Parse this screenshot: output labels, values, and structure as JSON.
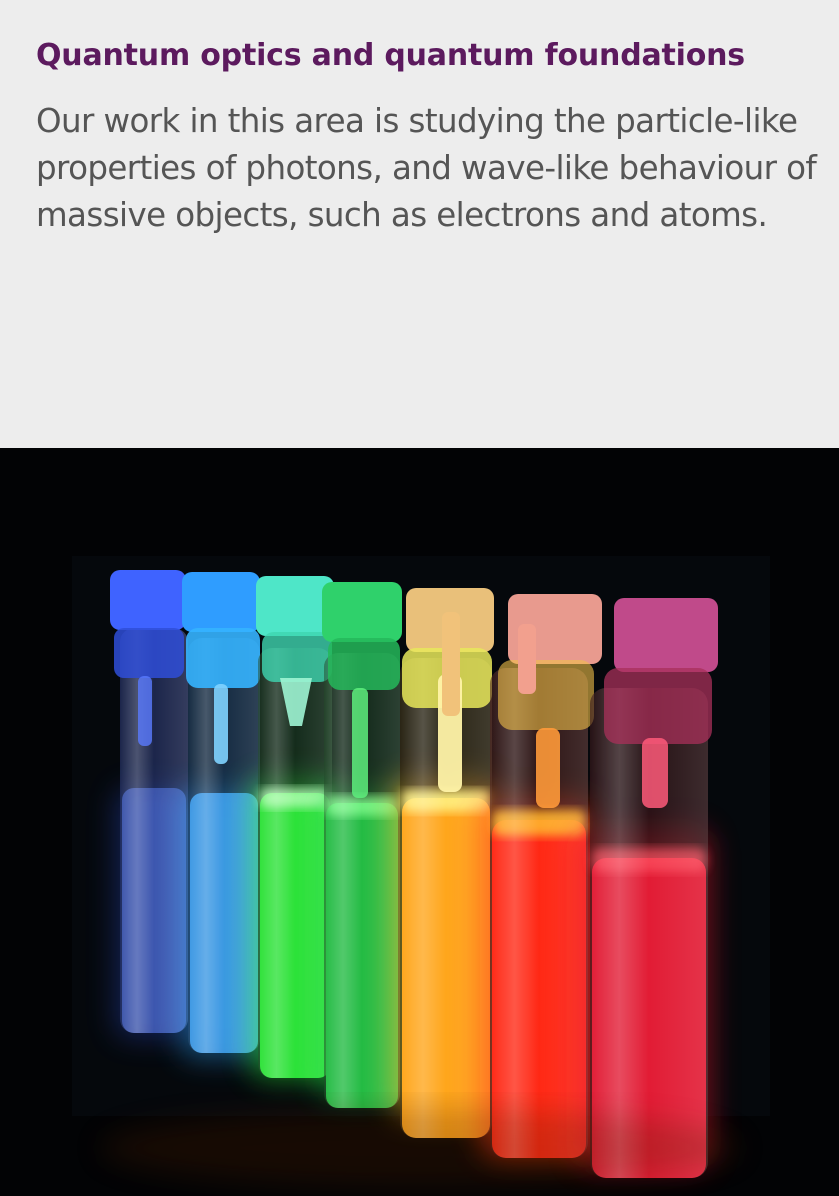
{
  "section": {
    "heading": "Quantum optics and quantum foundations",
    "description": "Our work in this area is studying the particle-like properties of photons, and wave-like behaviour of massive objects, such as electrons and atoms."
  },
  "image": {
    "subject": "fluorescent-vials",
    "vial_colors": [
      "#3a6bff",
      "#2ea8ff",
      "#2cff3a",
      "#1fd84a",
      "#ffb21a",
      "#ff3a10",
      "#e8122a"
    ]
  },
  "colors": {
    "panel_background": "#ededed",
    "heading": "#5c1a5e",
    "body_text": "#555555",
    "photo_background": "#020305"
  }
}
